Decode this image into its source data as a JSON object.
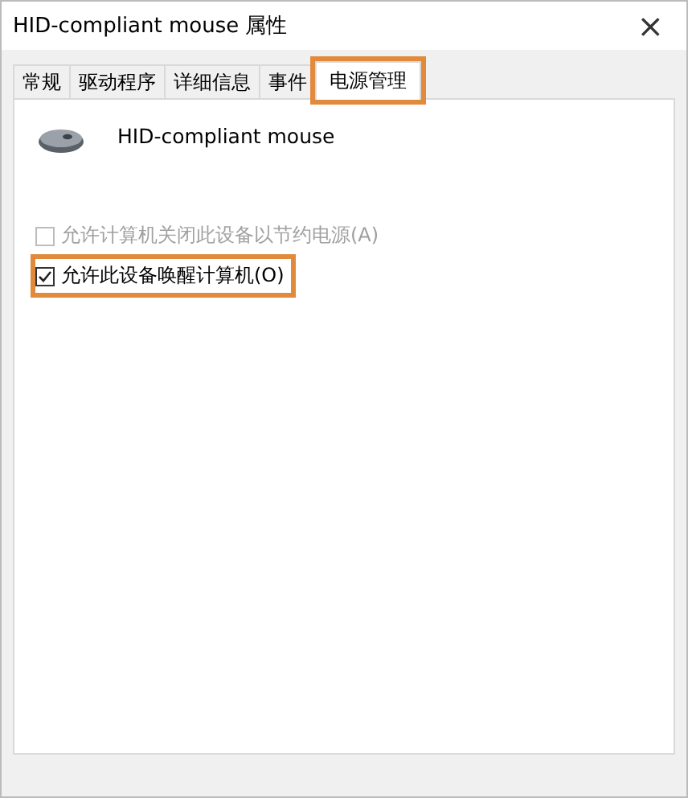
{
  "window": {
    "title": "HID-compliant mouse 属性",
    "close": "×"
  },
  "tabs": [
    {
      "label": "常规",
      "selected": false,
      "highlighted": false
    },
    {
      "label": "驱动程序",
      "selected": false,
      "highlighted": false
    },
    {
      "label": "详细信息",
      "selected": false,
      "highlighted": false
    },
    {
      "label": "事件",
      "selected": false,
      "highlighted": false
    },
    {
      "label": "电源管理",
      "selected": true,
      "highlighted": true
    }
  ],
  "device": {
    "name": "HID-compliant mouse"
  },
  "options": [
    {
      "label": "允许计算机关闭此设备以节约电源(A)",
      "checked": false,
      "disabled": true,
      "highlighted": false
    },
    {
      "label": "允许此设备唤醒计算机(O)",
      "checked": true,
      "disabled": false,
      "highlighted": true
    }
  ]
}
